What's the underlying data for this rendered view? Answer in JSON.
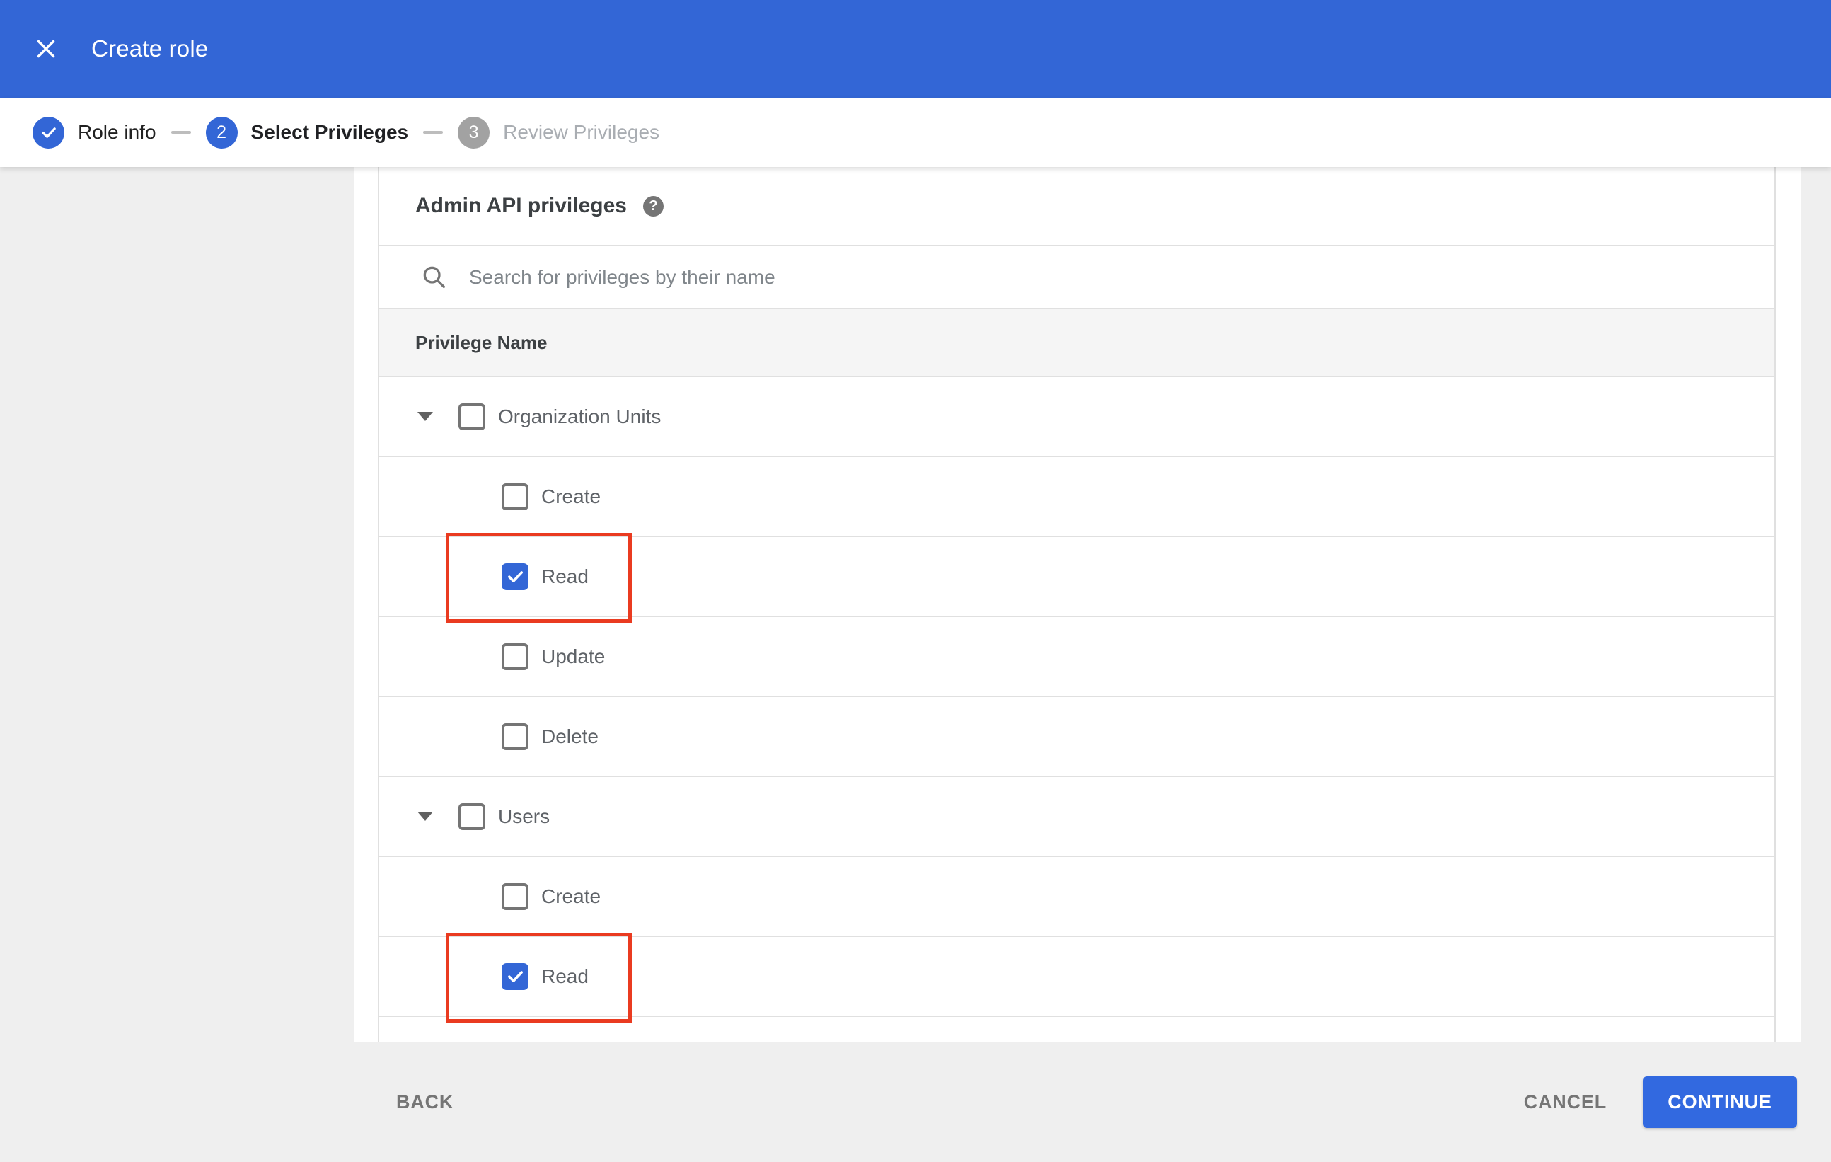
{
  "colors": {
    "header_blue": "#3366d6",
    "button_blue": "#3269e0",
    "highlight_red": "#ea3b20",
    "footer_bg": "#efefef",
    "band_bg": "#f5f5f5",
    "divider": "#e0e0e0"
  },
  "header": {
    "title": "Create role"
  },
  "stepper": {
    "steps": [
      {
        "number": "1",
        "label": "Role info",
        "state": "complete"
      },
      {
        "number": "2",
        "label": "Select Privileges",
        "state": "active"
      },
      {
        "number": "3",
        "label": "Review Privileges",
        "state": "upcoming"
      }
    ]
  },
  "privileges": {
    "title": "Admin API privileges",
    "help_glyph": "?",
    "search_placeholder": "Search for privileges by their name",
    "column_header": "Privilege Name",
    "rows": [
      {
        "label": "Organization Units",
        "level": "group",
        "expanded": true,
        "checked": false,
        "highlighted": false
      },
      {
        "label": "Create",
        "level": "child",
        "checked": false,
        "highlighted": false
      },
      {
        "label": "Read",
        "level": "child",
        "checked": true,
        "highlighted": true
      },
      {
        "label": "Update",
        "level": "child",
        "checked": false,
        "highlighted": false
      },
      {
        "label": "Delete",
        "level": "child",
        "checked": false,
        "highlighted": false
      },
      {
        "label": "Users",
        "level": "group",
        "expanded": true,
        "checked": false,
        "highlighted": false
      },
      {
        "label": "Create",
        "level": "child",
        "checked": false,
        "highlighted": false
      },
      {
        "label": "Read",
        "level": "child",
        "checked": true,
        "highlighted": true
      }
    ]
  },
  "footer": {
    "back": "BACK",
    "cancel": "CANCEL",
    "continue": "CONTINUE"
  }
}
